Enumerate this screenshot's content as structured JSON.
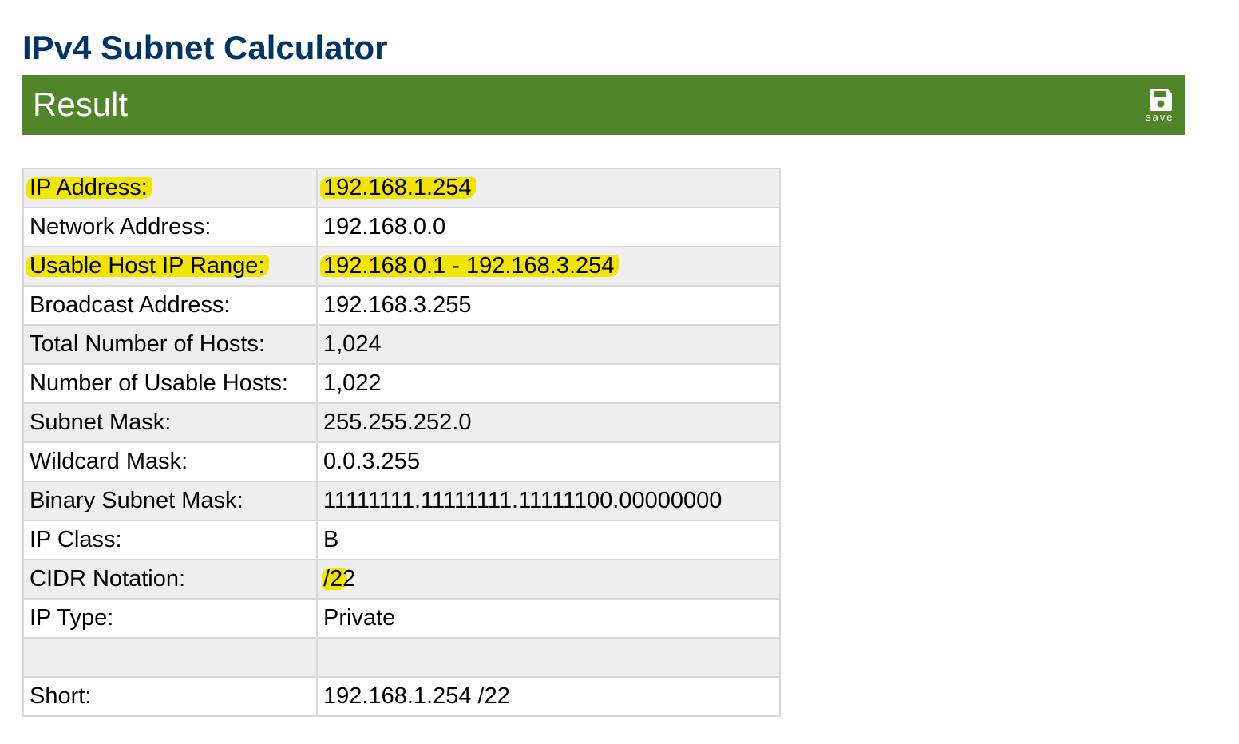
{
  "page": {
    "title": "IPv4 Subnet Calculator"
  },
  "result": {
    "title": "Result",
    "save_label": "save",
    "save_icon": "floppy-disk-icon"
  },
  "colors": {
    "title": "#003366",
    "result_bar": "#51852a",
    "row_alt": "#eeeeee",
    "highlight": "#f2e600"
  },
  "rows": [
    {
      "label": "IP Address:",
      "value": "192.168.1.254",
      "highlighted": true
    },
    {
      "label": "Network Address:",
      "value": "192.168.0.0"
    },
    {
      "label": "Usable Host IP Range:",
      "value": "192.168.0.1 - 192.168.3.254",
      "highlighted": true
    },
    {
      "label": "Broadcast Address:",
      "value": "192.168.3.255"
    },
    {
      "label": "Total Number of Hosts:",
      "value": "1,024"
    },
    {
      "label": "Number of Usable Hosts:",
      "value": "1,022"
    },
    {
      "label": "Subnet Mask:",
      "value": "255.255.252.0"
    },
    {
      "label": "Wildcard Mask:",
      "value": "0.0.3.255"
    },
    {
      "label": "Binary Subnet Mask:",
      "value": "11111111.11111111.11111100.00000000"
    },
    {
      "label": "IP Class:",
      "value": "B"
    },
    {
      "label": "CIDR Notation:",
      "value": "/22",
      "highlighted": true
    },
    {
      "label": "IP Type:",
      "value": "Private"
    },
    {
      "label": "",
      "value": ""
    },
    {
      "label": "Short:",
      "value": "192.168.1.254 /22"
    }
  ]
}
